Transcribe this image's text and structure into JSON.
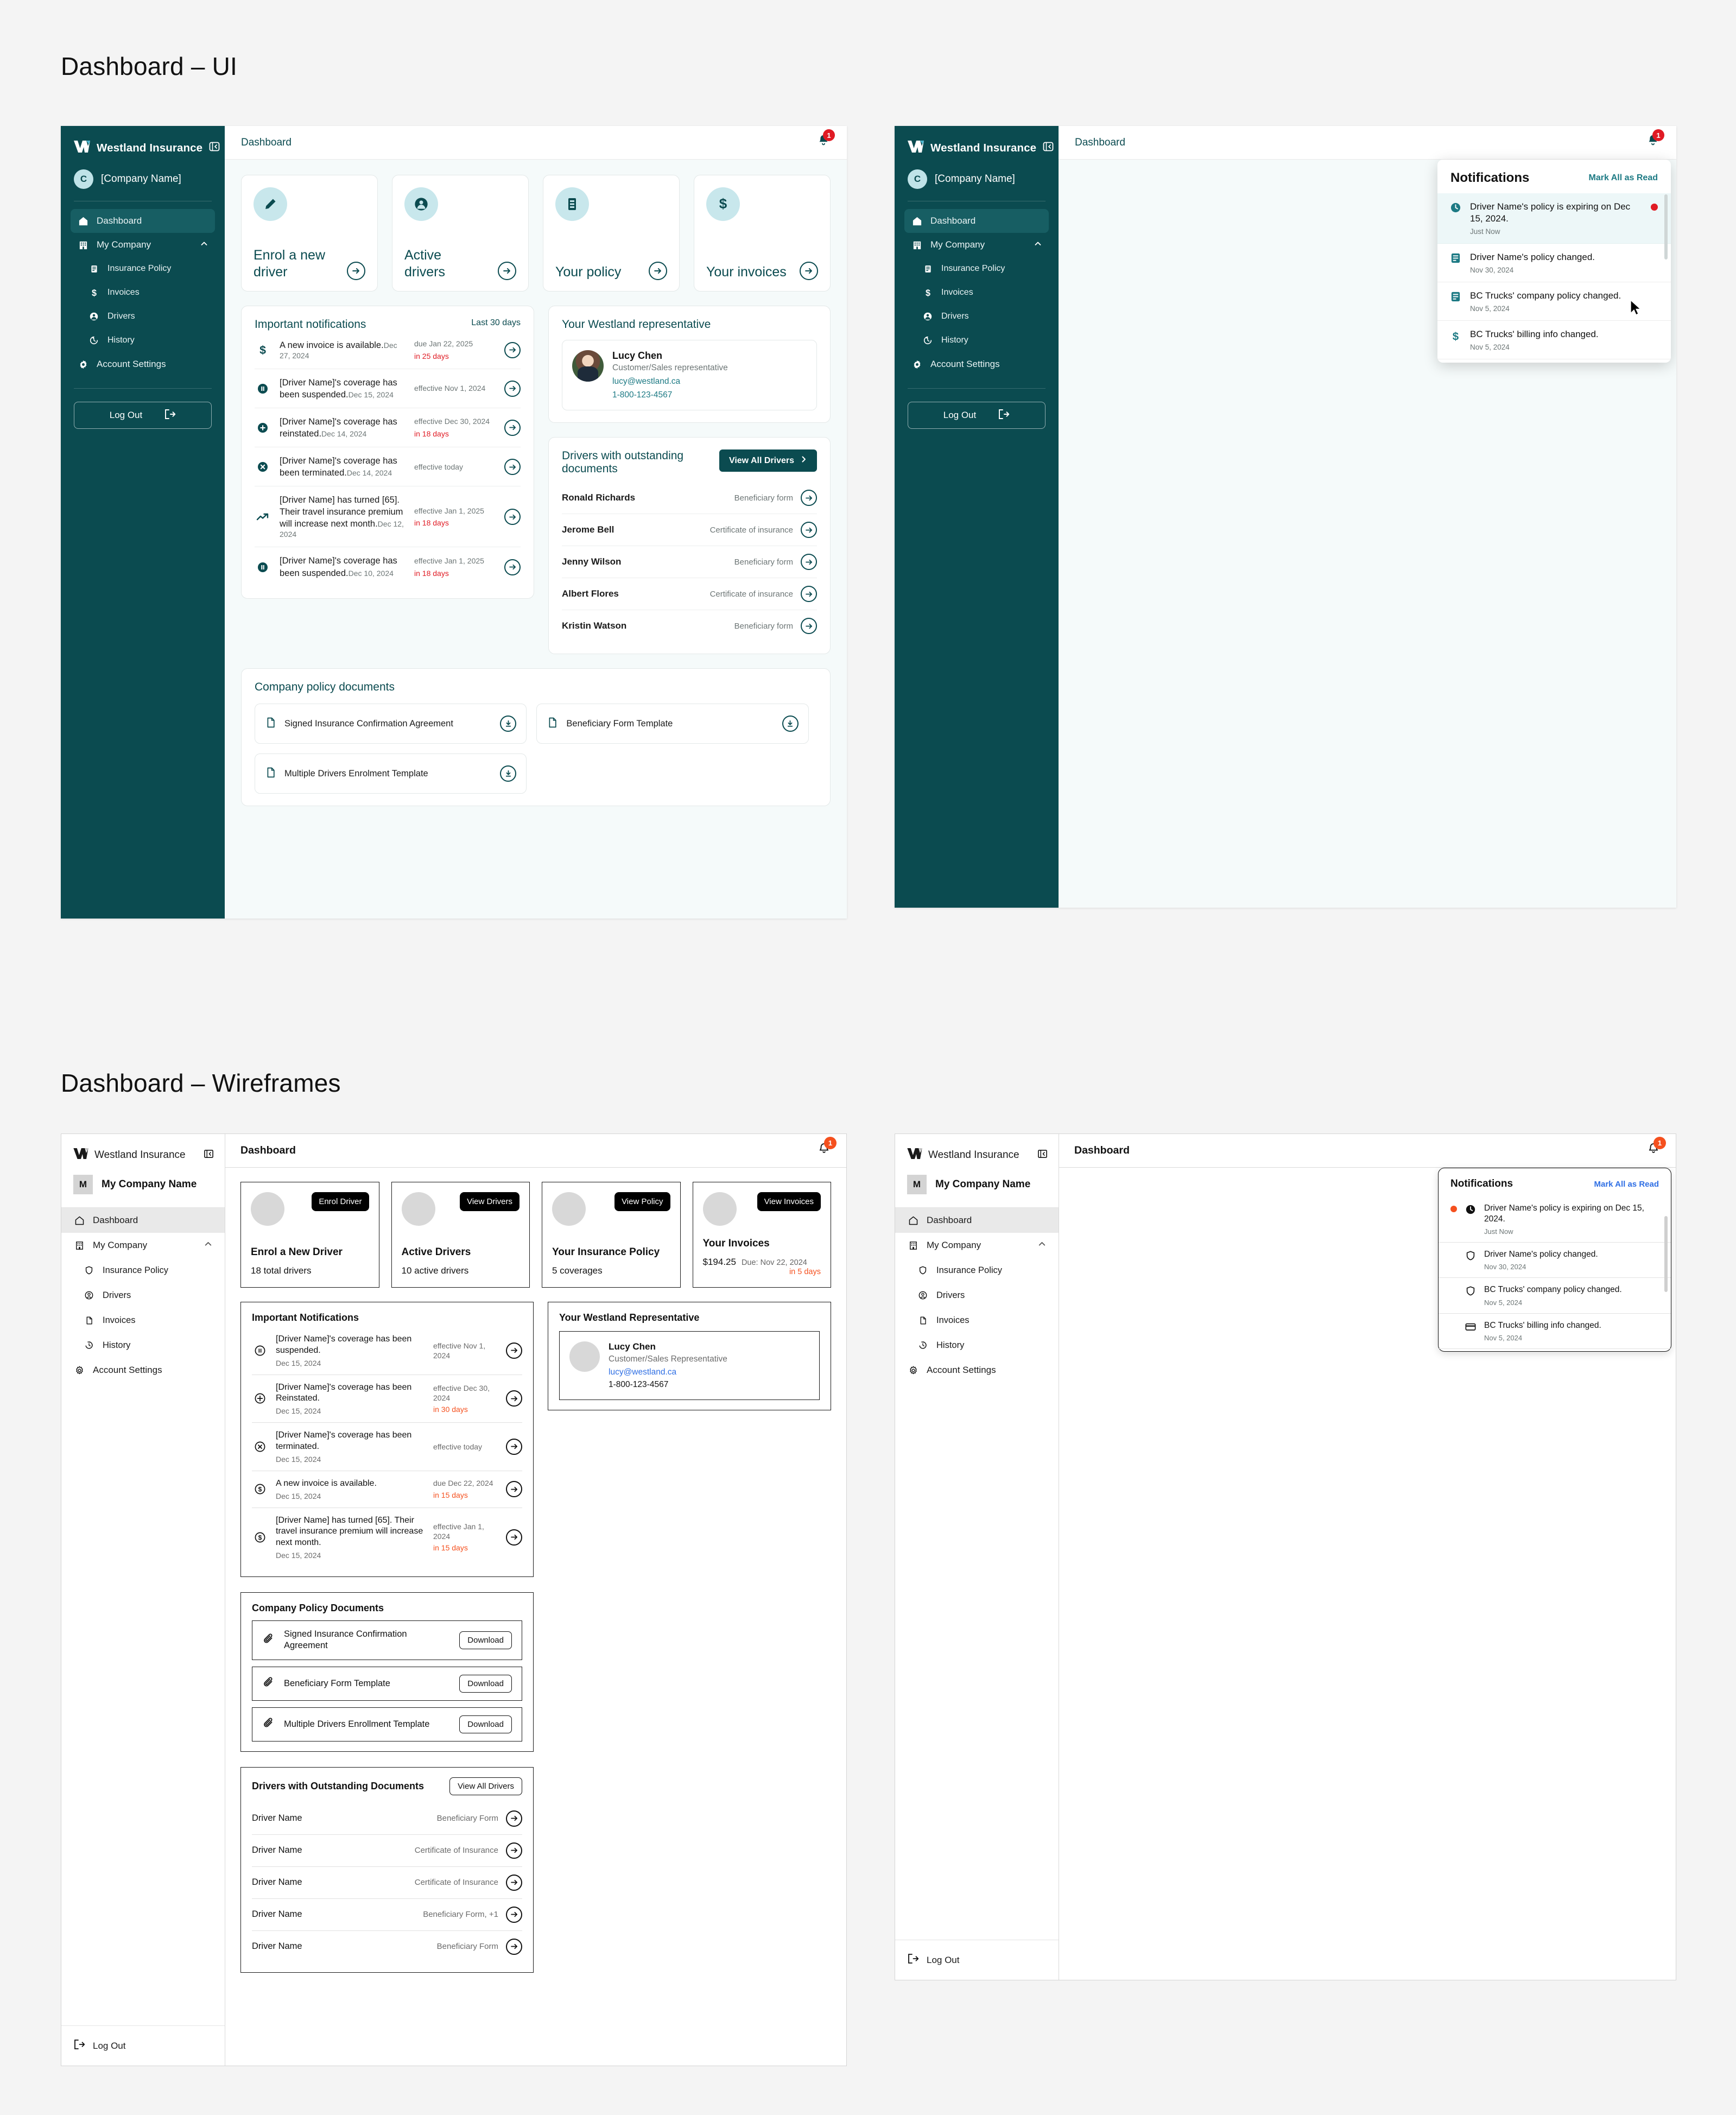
{
  "sections": {
    "ui_title": "Dashboard – UI",
    "wireframe_title": "Dashboard – Wireframes"
  },
  "brand": {
    "name": "Westland Insurance"
  },
  "ui": {
    "sidebar": {
      "company_initial": "C",
      "company_name": "[Company Name]",
      "items": [
        {
          "label": "Dashboard",
          "icon": "home-icon"
        },
        {
          "label": "My Company",
          "icon": "building-icon"
        },
        {
          "label": "Insurance Policy",
          "icon": "document-icon"
        },
        {
          "label": "Invoices",
          "icon": "dollar-icon"
        },
        {
          "label": "Drivers",
          "icon": "person-icon"
        },
        {
          "label": "History",
          "icon": "history-icon"
        },
        {
          "label": "Account Settings",
          "icon": "gear-icon"
        }
      ],
      "logout_label": "Log Out"
    },
    "topbar": {
      "page_title": "Dashboard",
      "bell_badge": "1"
    },
    "stat_cards": [
      {
        "label": "Enrol a new driver",
        "icon": "pencil-icon"
      },
      {
        "label": "Active drivers",
        "icon": "person-icon"
      },
      {
        "label": "Your policy",
        "icon": "document-icon"
      },
      {
        "label": "Your invoices",
        "icon": "dollar-icon"
      }
    ],
    "notifications_panel": {
      "title": "Important notifications",
      "range": "Last 30 days",
      "rows": [
        {
          "icon": "dollar-icon",
          "text": "A new invoice is available.",
          "date": "Dec 27, 2024",
          "meta": "due Jan 22, 2025",
          "days": "in 25 days"
        },
        {
          "icon": "pause-icon",
          "text": "[Driver Name]'s coverage has been suspended.",
          "date": "Dec 15, 2024",
          "meta": "effective Nov 1, 2024",
          "days": ""
        },
        {
          "icon": "plus-icon",
          "text": "[Driver Name]'s coverage has reinstated.",
          "date": "Dec 14, 2024",
          "meta": "effective Dec 30, 2024",
          "days": "in 18 days"
        },
        {
          "icon": "close-icon",
          "text": "[Driver Name]'s coverage has been terminated.",
          "date": "Dec 14, 2024",
          "meta": "effective today",
          "days": ""
        },
        {
          "icon": "trend-up-icon",
          "text": "[Driver Name] has turned [65]. Their travel insurance premium will increase next month.",
          "date": "Dec 12, 2024",
          "meta": "effective Jan 1, 2025",
          "days": "in 18 days"
        },
        {
          "icon": "pause-icon",
          "text": "[Driver Name]'s coverage has been suspended.",
          "date": "Dec 10, 2024",
          "meta": "effective Jan 1, 2025",
          "days": "in 18 days"
        }
      ]
    },
    "representative_panel": {
      "title": "Your Westland representative",
      "name": "Lucy Chen",
      "role": "Customer/Sales representative",
      "email": "lucy@westland.ca",
      "phone": "1-800-123-4567"
    },
    "drivers_panel": {
      "title": "Drivers with outstanding documents",
      "view_all_label": "View All Drivers",
      "rows": [
        {
          "name": "Ronald Richards",
          "doc": "Beneficiary form"
        },
        {
          "name": "Jerome Bell",
          "doc": "Certificate of insurance"
        },
        {
          "name": "Jenny Wilson",
          "doc": "Beneficiary form"
        },
        {
          "name": "Albert Flores",
          "doc": "Certificate of insurance"
        },
        {
          "name": "Kristin Watson",
          "doc": "Beneficiary form"
        }
      ]
    },
    "documents_panel": {
      "title": "Company policy documents",
      "docs": [
        "Signed Insurance Confirmation Agreement",
        "Beneficiary Form Template",
        "Multiple Drivers Enrolment Template"
      ]
    },
    "dropdown": {
      "title": "Notifications",
      "mark_all_label": "Mark All as Read",
      "items": [
        {
          "icon": "clock-icon",
          "text": "Driver Name's policy is expiring on Dec 15, 2024.",
          "time": "Just Now",
          "unread": true
        },
        {
          "icon": "document-icon",
          "text": "Driver Name's policy changed.",
          "time": "Nov 30, 2024",
          "unread": false
        },
        {
          "icon": "document-icon",
          "text": "BC Trucks' company policy changed.",
          "time": "Nov 5, 2024",
          "unread": false
        },
        {
          "icon": "dollar-icon",
          "text": "BC Trucks' billing info changed.",
          "time": "Nov 5, 2024",
          "unread": false
        }
      ]
    }
  },
  "wireframe": {
    "sidebar": {
      "company_initial": "M",
      "company_name": "My Company Name",
      "items": [
        {
          "label": "Dashboard",
          "icon": "home-icon"
        },
        {
          "label": "My Company",
          "icon": "building-icon"
        },
        {
          "label": "Insurance Policy",
          "icon": "shield-icon"
        },
        {
          "label": "Drivers",
          "icon": "person-icon"
        },
        {
          "label": "Invoices",
          "icon": "file-icon"
        },
        {
          "label": "History",
          "icon": "history-icon"
        },
        {
          "label": "Account Settings",
          "icon": "gear-icon"
        }
      ],
      "logout_label": "Log Out"
    },
    "topbar": {
      "page_title": "Dashboard",
      "bell_badge": "1"
    },
    "stat_cards": [
      {
        "button": "Enrol Driver",
        "title": "Enrol a New Driver",
        "sub": "18 total drivers",
        "muted": "",
        "warn": ""
      },
      {
        "button": "View Drivers",
        "title": "Active Drivers",
        "sub": "10 active drivers",
        "muted": "",
        "warn": ""
      },
      {
        "button": "View Policy",
        "title": "Your Insurance Policy",
        "sub": "5 coverages",
        "muted": "",
        "warn": ""
      },
      {
        "button": "View Invoices",
        "title": "Your Invoices",
        "sub": "$194.25",
        "muted": "Due: Nov 22, 2024",
        "warn": "in 5 days"
      }
    ],
    "notifications_panel": {
      "title": "Important Notifications",
      "rows": [
        {
          "icon": "pause-icon",
          "text": "[Driver Name]'s coverage has been suspended.",
          "date": "Dec 15, 2024",
          "meta": "effective Nov 1, 2024",
          "days": ""
        },
        {
          "icon": "plus-icon",
          "text": "[Driver Name]'s coverage has been Reinstated.",
          "date": "Dec 15, 2024",
          "meta": "effective Dec 30, 2024",
          "days": "in 30 days"
        },
        {
          "icon": "close-icon",
          "text": "[Driver Name]'s coverage has been terminated.",
          "date": "Dec 15, 2024",
          "meta": "effective today",
          "days": ""
        },
        {
          "icon": "dollar-icon",
          "text": "A new invoice is available.",
          "date": "Dec 15, 2024",
          "meta": "due Dec 22, 2024",
          "days": "in 15 days"
        },
        {
          "icon": "dollar-icon",
          "text": "[Driver Name] has turned [65]. Their travel insurance premium will increase next month.",
          "date": "Dec 15, 2024",
          "meta": "effective Jan 1, 2024",
          "days": "in 15 days"
        }
      ]
    },
    "representative_panel": {
      "title": "Your Westland Representative",
      "name": "Lucy Chen",
      "role": "Customer/Sales Representative",
      "email": "lucy@westland.ca",
      "phone": "1-800-123-4567"
    },
    "documents_panel": {
      "title": "Company Policy Documents",
      "download_label": "Download",
      "docs": [
        "Signed Insurance Confirmation Agreement",
        "Beneficiary Form Template",
        "Multiple Drivers Enrollment Template"
      ]
    },
    "drivers_panel": {
      "title": "Drivers with Outstanding Documents",
      "view_all_label": "View All Drivers",
      "rows": [
        {
          "name": "Driver Name",
          "doc": "Beneficiary Form"
        },
        {
          "name": "Driver Name",
          "doc": "Certificate of Insurance"
        },
        {
          "name": "Driver Name",
          "doc": "Certificate of Insurance"
        },
        {
          "name": "Driver Name",
          "doc": "Beneficiary Form, +1"
        },
        {
          "name": "Driver Name",
          "doc": "Beneficiary Form"
        }
      ]
    },
    "dropdown": {
      "title": "Notifications",
      "mark_all_label": "Mark All as Read",
      "items": [
        {
          "icon": "clock-icon",
          "text": "Driver Name's policy is expiring on Dec 15, 2024.",
          "time": "Just Now",
          "unread": true
        },
        {
          "icon": "shield-icon",
          "text": "Driver Name's policy changed.",
          "time": "Nov 30, 2024",
          "unread": false
        },
        {
          "icon": "shield-icon",
          "text": "BC Trucks' company policy changed.",
          "time": "Nov 5, 2024",
          "unread": false
        },
        {
          "icon": "card-icon",
          "text": "BC Trucks' billing info changed.",
          "time": "Nov 5, 2024",
          "unread": false
        }
      ]
    }
  },
  "colors": {
    "teal": "#0b4b50",
    "teal_light": "#c8e7ec",
    "accent_link": "#1d7a84",
    "red": "#e01b24",
    "orange": "#f5501e",
    "page_bg": "#f4f4f4"
  }
}
